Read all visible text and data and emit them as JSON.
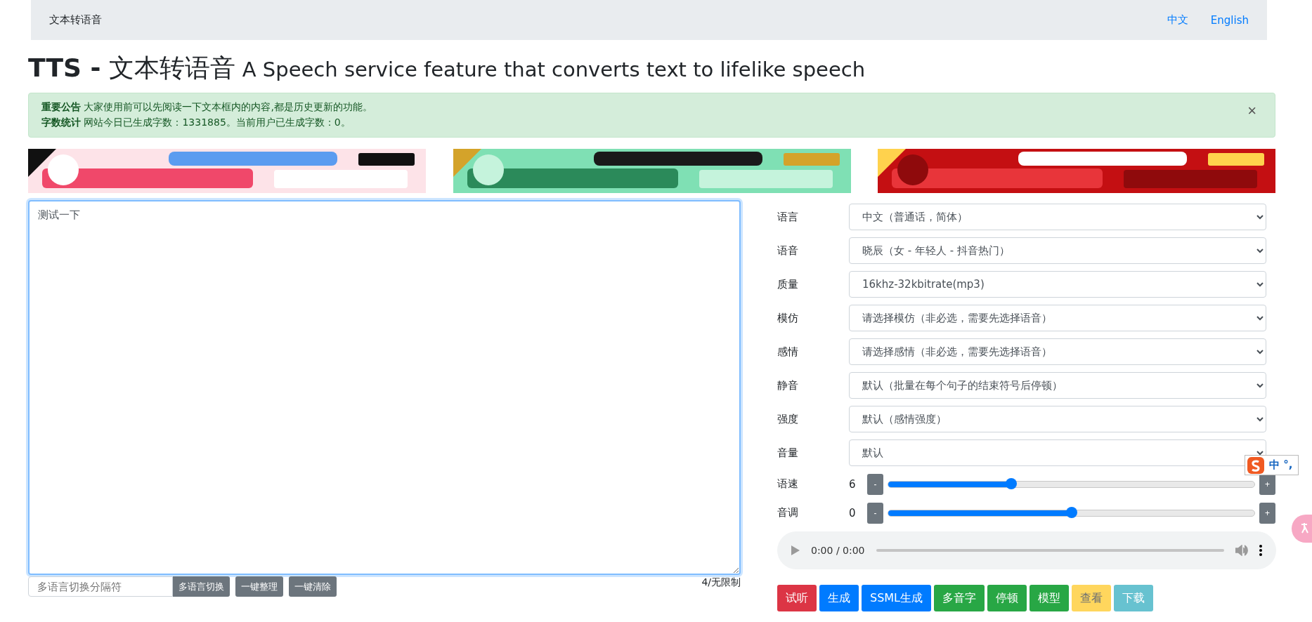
{
  "navbar": {
    "brand": "文本转语音",
    "links": [
      {
        "label": "中文"
      },
      {
        "label": "English"
      }
    ]
  },
  "heading": {
    "title": "**TTS -** 文本转语音",
    "subtitle": "A Speech service feature that converts text to lifelike speech"
  },
  "alert": {
    "lines": [
      "**重要公告** 大家使用前可以先阅读一下文本框内的内容,都是历史更新的功能。",
      "**字数统计** 网站今日已生成字数：1331885。当前用户已生成字数：0。"
    ],
    "close": "×"
  },
  "editor": {
    "value": "测试一下",
    "separator_placeholder": "多语言切换分隔符",
    "buttons": [
      "多语言切换",
      "一键整理",
      "一键清除"
    ],
    "count": "4/无限制"
  },
  "settings": [
    {
      "label": "语言",
      "value": "中文（普通话，简体）"
    },
    {
      "label": "语音",
      "value": "晓辰（女 - 年轻人 - 抖音热门）"
    },
    {
      "label": "质量",
      "value": "16khz-32kbitrate(mp3)"
    },
    {
      "label": "模仿",
      "value": "请选择模仿（非必选，需要先选择语音）"
    },
    {
      "label": "感情",
      "value": "请选择感情（非必选，需要先选择语音）"
    },
    {
      "label": "静音",
      "value": "默认（批量在每个句子的结束符号后停顿）"
    },
    {
      "label": "强度",
      "value": "默认（感情强度）"
    },
    {
      "label": "音量",
      "value": "默认"
    }
  ],
  "sliders": [
    {
      "label": "语速",
      "reading": "6",
      "minus": "-",
      "plus": "+",
      "level": 0.335
    },
    {
      "label": "音调",
      "reading": "0",
      "minus": "-",
      "plus": "+",
      "level": 0.5
    }
  ],
  "player": {
    "time": "0:00 / 0:00"
  },
  "actions": [
    {
      "label": "试听",
      "kind": "danger",
      "disabled": false
    },
    {
      "label": "生成",
      "kind": "primary",
      "disabled": false
    },
    {
      "label": "SSML生成",
      "kind": "primary",
      "disabled": false
    },
    {
      "label": "多音字",
      "kind": "success",
      "disabled": false
    },
    {
      "label": "停顿",
      "kind": "success",
      "disabled": false
    },
    {
      "label": "模型",
      "kind": "success",
      "disabled": false
    },
    {
      "label": "查看",
      "kind": "warning",
      "disabled": true
    },
    {
      "label": "下载",
      "kind": "info",
      "disabled": true
    }
  ],
  "ime_toolbar": {
    "text": "中 °,"
  }
}
